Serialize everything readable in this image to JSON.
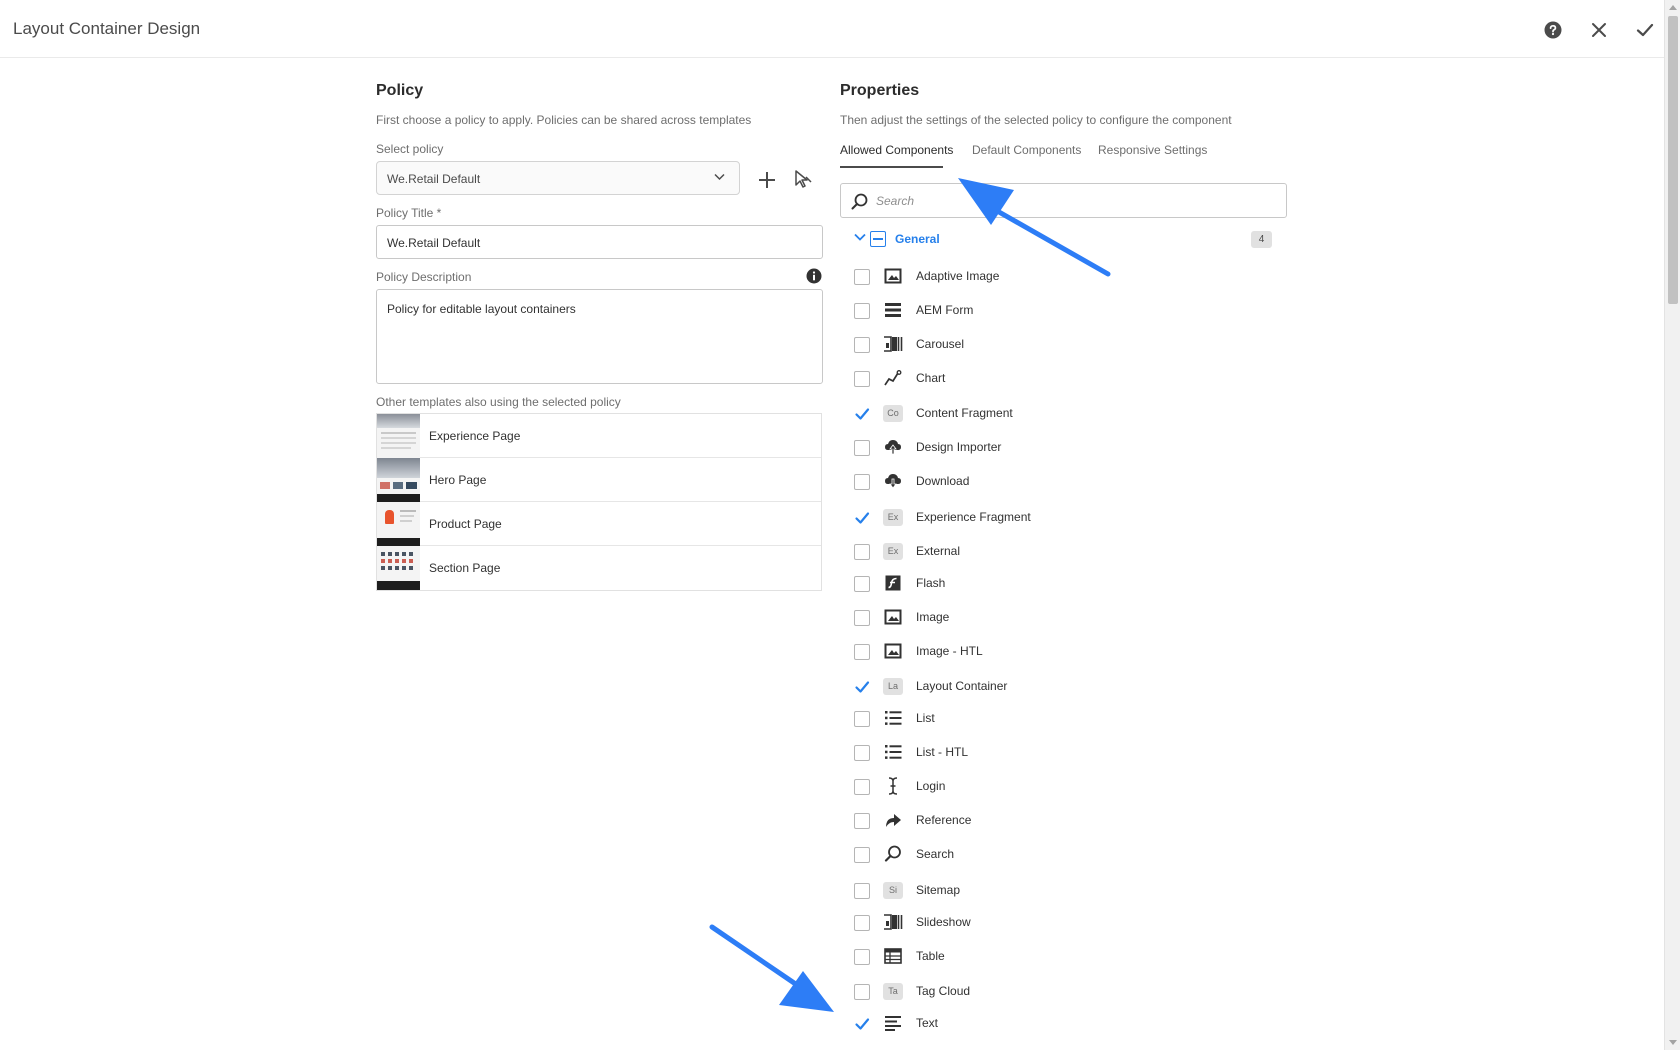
{
  "header": {
    "title": "Layout Container Design"
  },
  "policy": {
    "heading": "Policy",
    "description": "First choose a policy to apply. Policies can be shared across templates",
    "select_label": "Select policy",
    "select_value": "We.Retail Default",
    "title_label": "Policy Title *",
    "title_value": "We.Retail Default",
    "description_label": "Policy Description",
    "description_value": "Policy for editable layout containers",
    "templates_label": "Other templates also using the selected policy",
    "templates": [
      {
        "name": "Experience Page"
      },
      {
        "name": "Hero Page"
      },
      {
        "name": "Product Page"
      },
      {
        "name": "Section Page"
      }
    ]
  },
  "properties": {
    "heading": "Properties",
    "description": "Then adjust the settings of the selected policy to configure the component",
    "tabs": [
      {
        "label": "Allowed Components"
      },
      {
        "label": "Default Components"
      },
      {
        "label": "Responsive Settings"
      }
    ],
    "search_placeholder": "Search",
    "group": {
      "name": "General",
      "count": "4"
    },
    "components": [
      {
        "name": "Adaptive Image",
        "icon": "image-icon",
        "checked": false
      },
      {
        "name": "AEM Form",
        "icon": "form-icon",
        "checked": false
      },
      {
        "name": "Carousel",
        "icon": "carousel-icon",
        "checked": false
      },
      {
        "name": "Chart",
        "icon": "chart-icon",
        "checked": false
      },
      {
        "name": "Content Fragment",
        "icon": "Co",
        "checked": true
      },
      {
        "name": "Design Importer",
        "icon": "cloud-upload-icon",
        "checked": false
      },
      {
        "name": "Download",
        "icon": "cloud-download-icon",
        "checked": false
      },
      {
        "name": "Experience Fragment",
        "icon": "Ex",
        "checked": true
      },
      {
        "name": "External",
        "icon": "Ex",
        "checked": false
      },
      {
        "name": "Flash",
        "icon": "flash-icon",
        "checked": false
      },
      {
        "name": "Image",
        "icon": "image-icon",
        "checked": false
      },
      {
        "name": "Image - HTL",
        "icon": "image-icon",
        "checked": false
      },
      {
        "name": "Layout Container",
        "icon": "La",
        "checked": true
      },
      {
        "name": "List",
        "icon": "list-icon",
        "checked": false
      },
      {
        "name": "List - HTL",
        "icon": "list-icon",
        "checked": false
      },
      {
        "name": "Login",
        "icon": "text-cursor-icon",
        "checked": false
      },
      {
        "name": "Reference",
        "icon": "share-arrow-icon",
        "checked": false
      },
      {
        "name": "Search",
        "icon": "search-icon",
        "checked": false
      },
      {
        "name": "Sitemap",
        "icon": "Si",
        "checked": false
      },
      {
        "name": "Slideshow",
        "icon": "carousel-icon",
        "checked": false
      },
      {
        "name": "Table",
        "icon": "table-icon",
        "checked": false
      },
      {
        "name": "Tag Cloud",
        "icon": "Ta",
        "checked": false
      },
      {
        "name": "Text",
        "icon": "text-align-icon",
        "checked": true
      }
    ]
  },
  "colors": {
    "accent": "#2680eb",
    "arrow": "#2d7df6"
  }
}
